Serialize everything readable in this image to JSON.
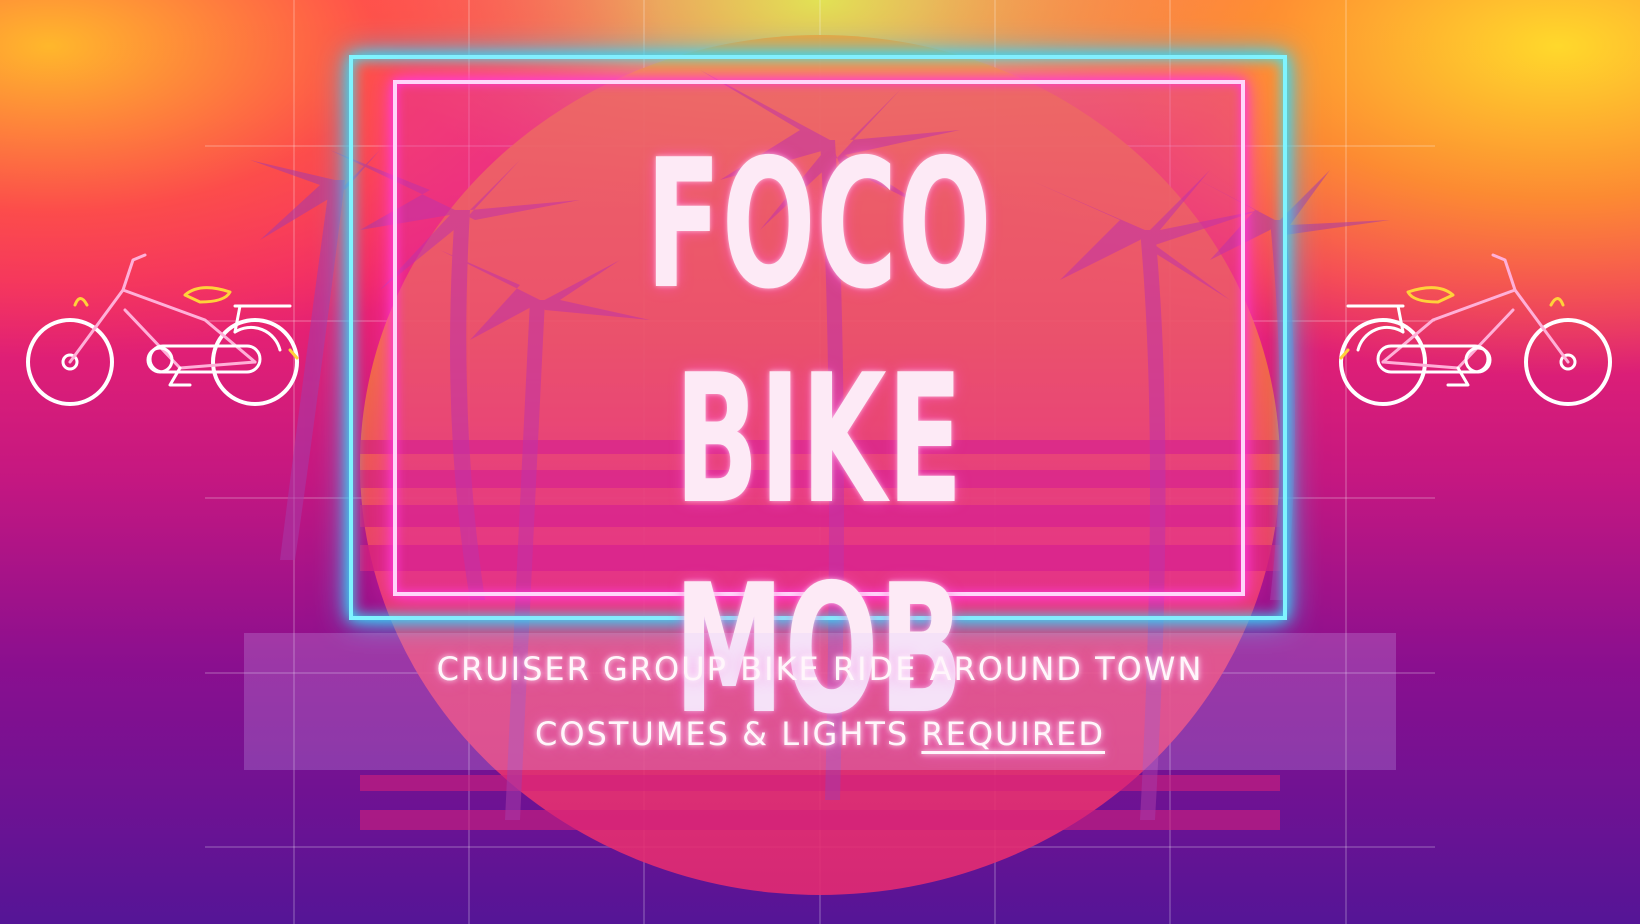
{
  "banner": {
    "title_line_1": "FOCO",
    "title_line_2": "BIKE MOB",
    "subtitle_line_1": "CRUISER GROUP BIKE RIDE AROUND TOWN",
    "subtitle_line_2_prefix": "COSTUMES & LIGHTS ",
    "subtitle_line_2_emphasis": "REQUIRED"
  },
  "decorations": {
    "left_icon": "bicycle-icon",
    "right_icon": "bicycle-icon",
    "background_motif": "palm-trees-sunset"
  },
  "colors": {
    "neon_cyan": "#7ff4ff",
    "neon_pink": "#ff3ad8",
    "title_text": "#fdeaf6",
    "sun_top": "#f8a030",
    "sun_bottom": "#e32a72"
  }
}
